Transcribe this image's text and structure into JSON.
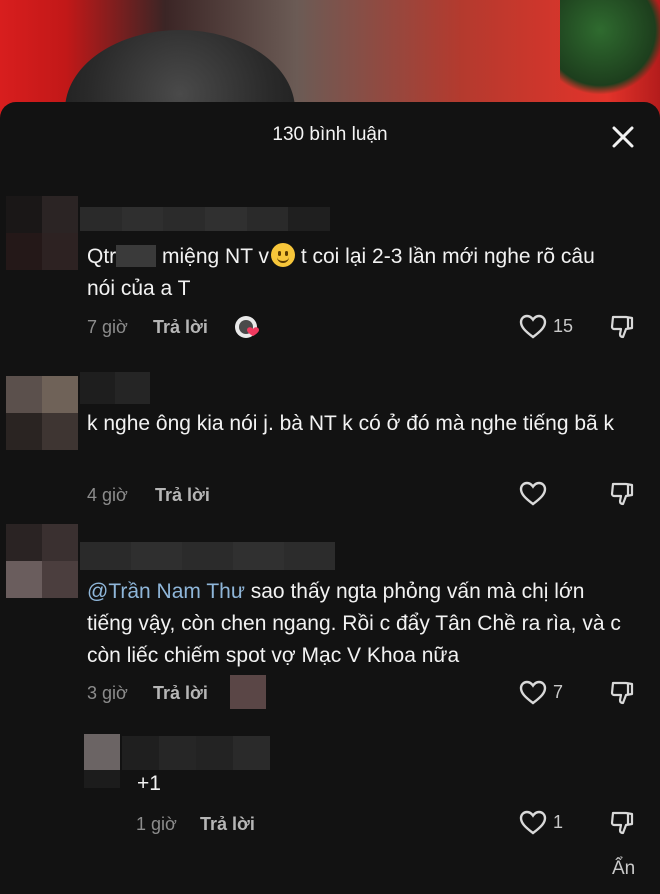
{
  "header": {
    "title": "130 bình luận",
    "close_icon": "close-icon"
  },
  "comments": [
    {
      "text_before": "Qtr",
      "text_after": " miệng NT v",
      "text_tail": " t coi lại 2-3 lần mới nghe rõ câu nói của a T",
      "time": "7 giờ",
      "reply_label": "Trả lời",
      "likes": "15"
    },
    {
      "text": "k nghe ông kia nói j. bà NT k có ở đó mà nghe tiếng bã k",
      "time": "4 giờ",
      "reply_label": "Trả lời",
      "likes": ""
    },
    {
      "mention": "@Trần Nam Thư",
      "text": " sao thấy ngta phỏng vấn mà chị lớn tiếng vậy, còn chen ngang. Rồi c đẩy Tân Chề ra rìa, và c còn liếc chiếm spot vợ Mạc V Khoa nữa",
      "time": "3 giờ",
      "reply_label": "Trả lời",
      "likes": "7"
    },
    {
      "text": "+1",
      "time": "1 giờ",
      "reply_label": "Trả lời",
      "likes": "1"
    }
  ],
  "footer": {
    "hide_label": "Ẩn"
  },
  "colors": {
    "background": "#121212",
    "text": "#f2f2f2",
    "muted": "#8c8c8c",
    "mention": "#8fb6d9",
    "emoji": "#f7c63a"
  }
}
